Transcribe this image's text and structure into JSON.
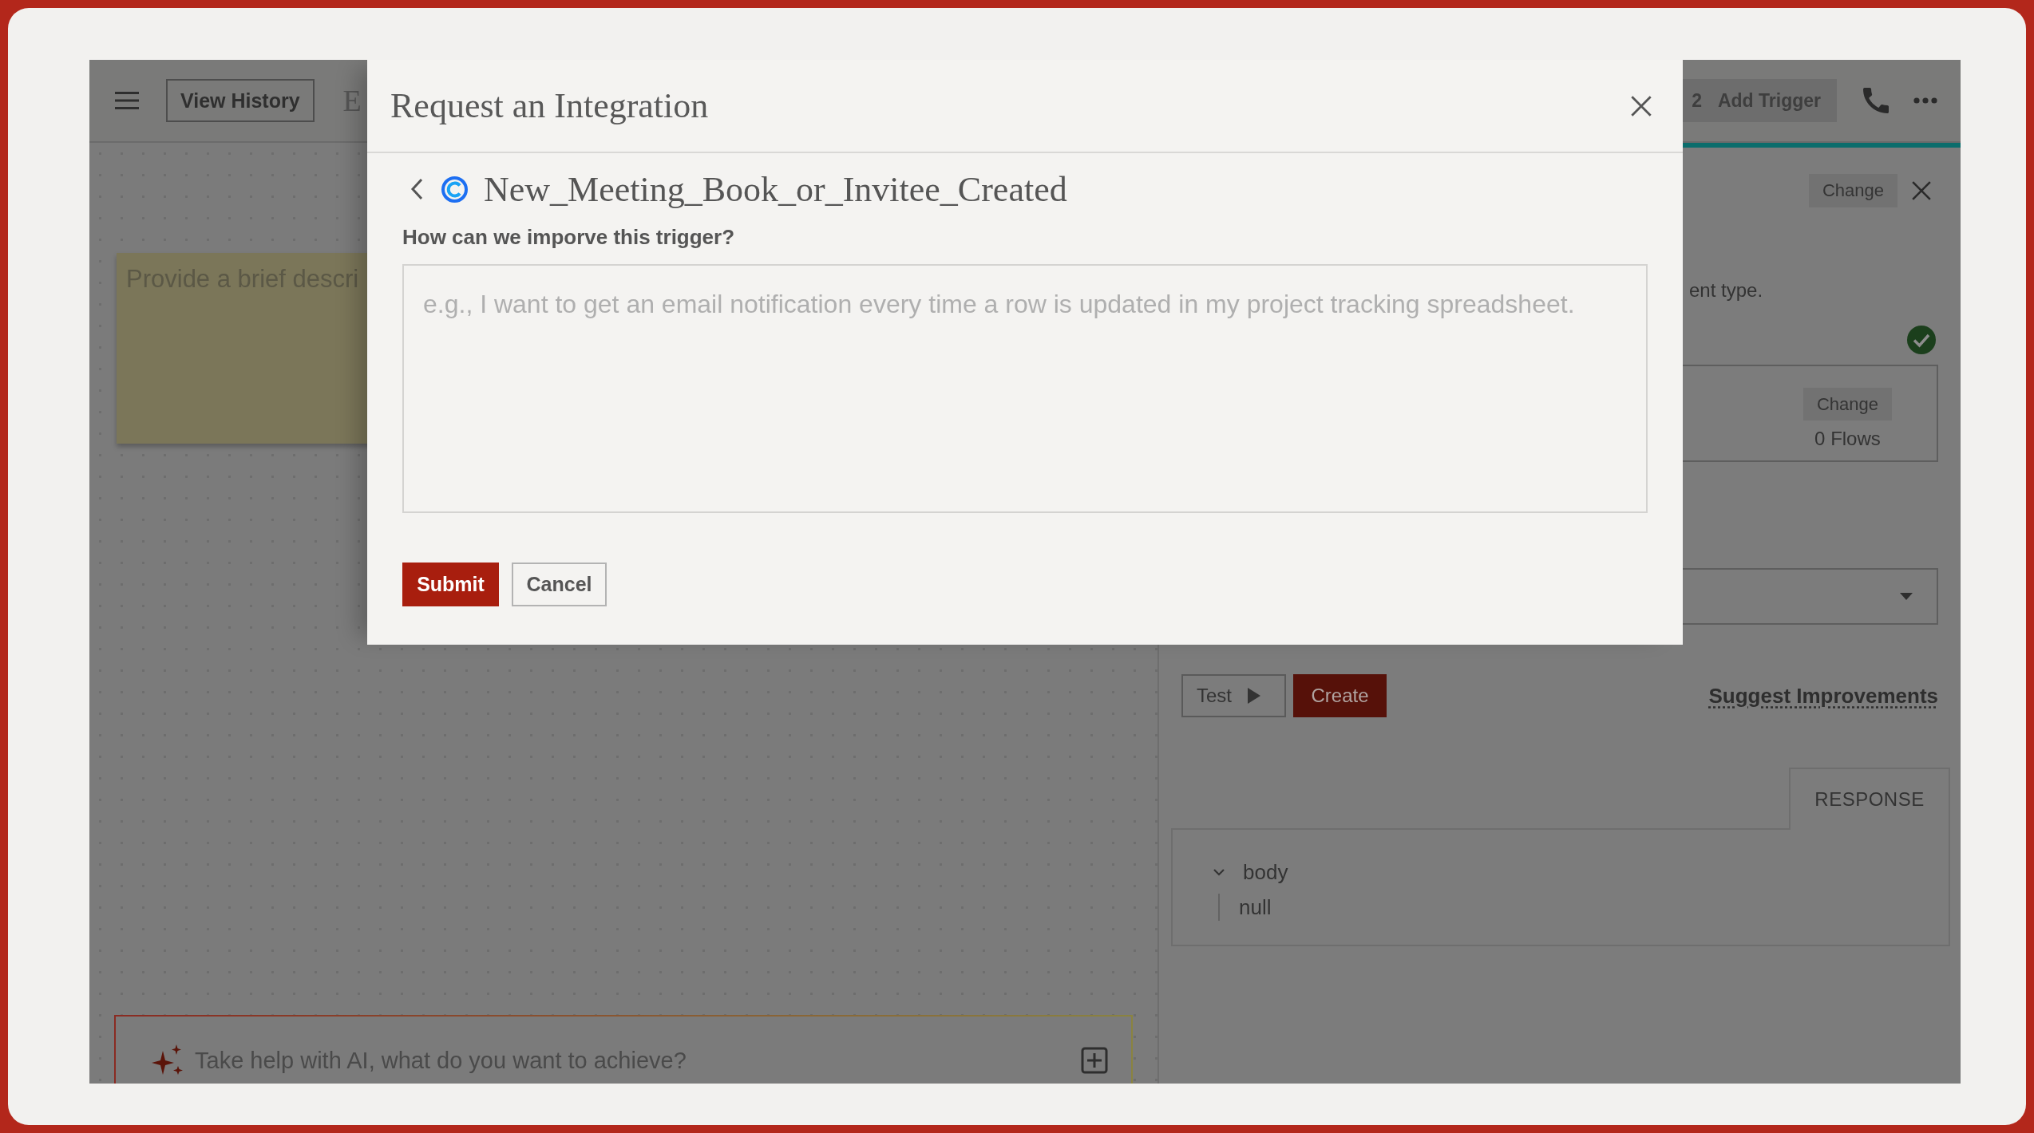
{
  "top_bar": {
    "view_history_button": "View History",
    "title": "E",
    "add_trigger_button": {
      "prefix": "2",
      "label": "Add Trigger"
    }
  },
  "canvas": {
    "note": {
      "placeholder": "Provide a brief descri"
    },
    "ai_prompt": {
      "placeholder": "Take help with AI, what do you want to achieve?"
    }
  },
  "side_panel": {
    "header_button": "Change",
    "description": "ent type.",
    "connected": true,
    "account_card": {
      "change_button": "Change",
      "flows": "0 Flows"
    },
    "test_button": "Test",
    "create_button": "Create",
    "suggest_link": "Suggest Improvements",
    "tabs": [
      {
        "label": "RESPONSE",
        "selected": true
      }
    ],
    "response_tree": [
      {
        "key": "body",
        "expanded": true,
        "children": [
          {
            "value": "null"
          }
        ]
      }
    ]
  },
  "dialog": {
    "title": "Request an Integration",
    "trigger_name": "New_Meeting_Book_or_Invitee_Created",
    "question": "How can we imporve this trigger?",
    "feedback_field": {
      "placeholder": "e.g., I want to get an email notification every time a row is updated in my project tracking spreadsheet."
    },
    "buttons": [
      {
        "kind": "primary",
        "label": "Submit"
      },
      {
        "kind": "secondary",
        "label": "Cancel"
      }
    ]
  }
}
